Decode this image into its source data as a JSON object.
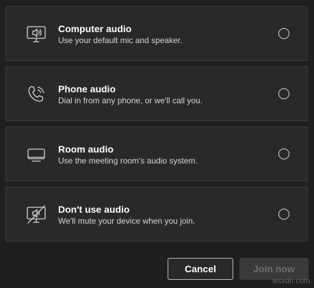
{
  "audio_options": [
    {
      "title": "Computer audio",
      "description": "Use your default mic and speaker.",
      "icon": "computer-speaker-icon",
      "selected": false
    },
    {
      "title": "Phone audio",
      "description": "Dial in from any phone, or we'll call you.",
      "icon": "phone-call-icon",
      "selected": false
    },
    {
      "title": "Room audio",
      "description": "Use the meeting room's audio system.",
      "icon": "room-device-icon",
      "selected": false
    },
    {
      "title": "Don't use audio",
      "description": "We'll mute your device when you join.",
      "icon": "no-audio-icon",
      "selected": false
    }
  ],
  "buttons": {
    "cancel_label": "Cancel",
    "join_label": "Join now",
    "join_enabled": false
  },
  "watermark": "wsxdn.com",
  "colors": {
    "background": "#1f1f1f",
    "card": "#292929",
    "card_border": "#3b3b3b",
    "text_primary": "#ffffff",
    "text_secondary": "#d6d6d6",
    "disabled_text": "#6e6e6e"
  }
}
